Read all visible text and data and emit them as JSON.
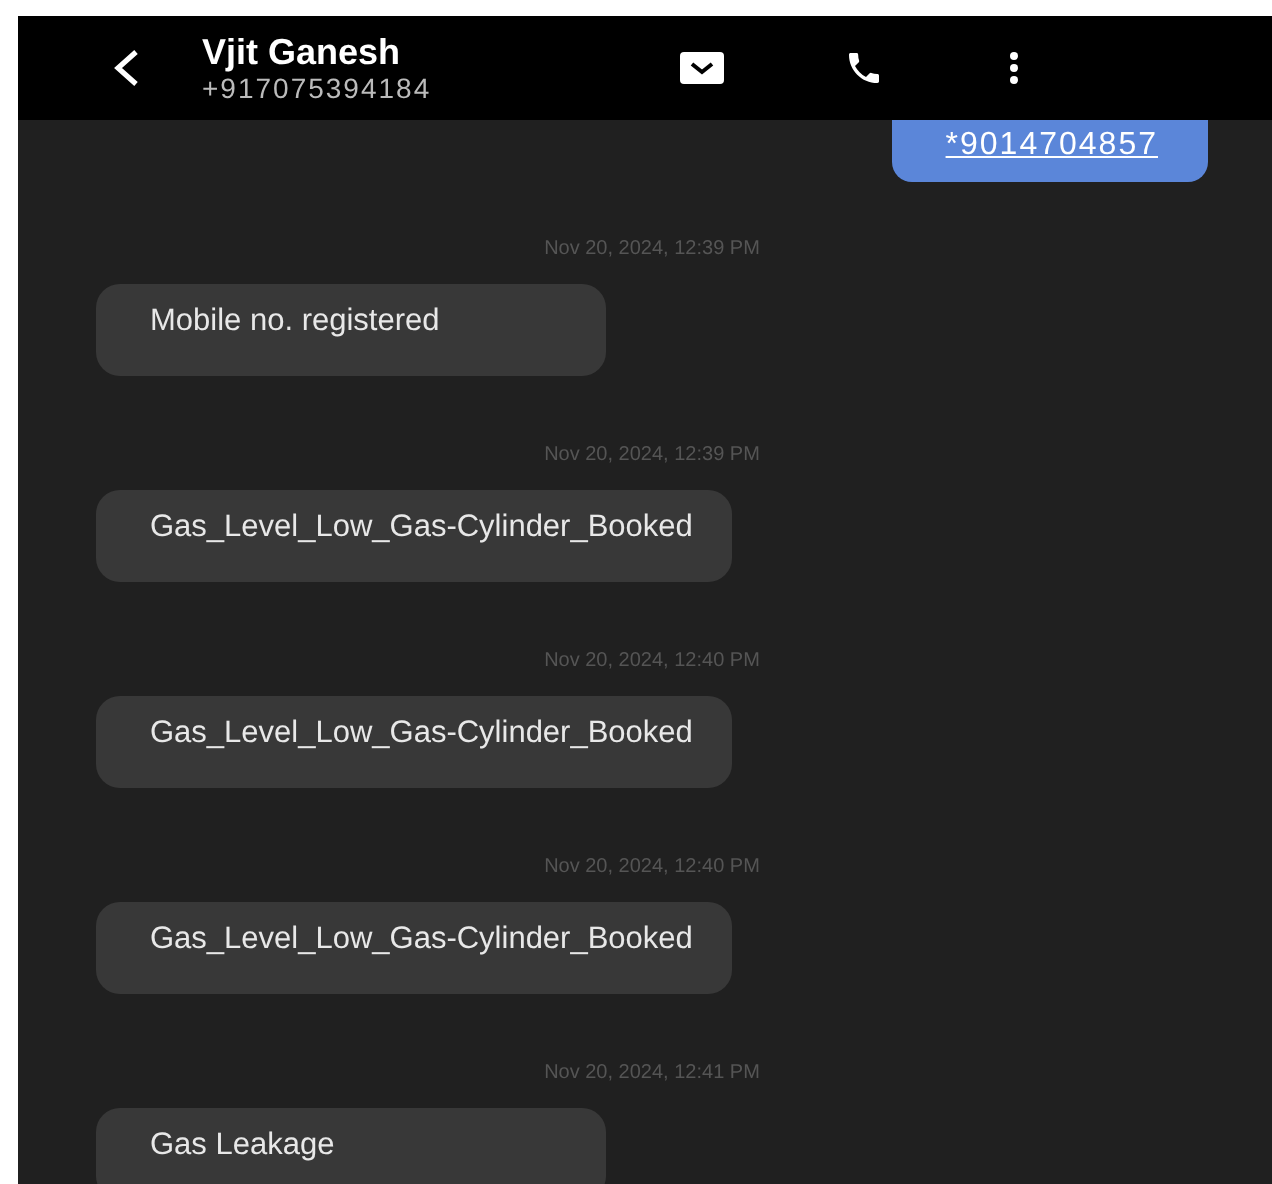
{
  "header": {
    "name": "Vjit Ganesh",
    "number": "+917075394184"
  },
  "messages": [
    {
      "kind": "sent",
      "text": "*9014704857"
    },
    {
      "kind": "timestamp",
      "text": "Nov 20, 2024, 12:39 PM"
    },
    {
      "kind": "received",
      "text": "Mobile no. registered"
    },
    {
      "kind": "timestamp",
      "text": "Nov 20, 2024, 12:39 PM"
    },
    {
      "kind": "received",
      "text": "Gas_Level_Low_Gas-Cylinder_Booked"
    },
    {
      "kind": "timestamp",
      "text": "Nov 20, 2024, 12:40 PM"
    },
    {
      "kind": "received",
      "text": "Gas_Level_Low_Gas-Cylinder_Booked"
    },
    {
      "kind": "timestamp",
      "text": "Nov 20, 2024, 12:40 PM"
    },
    {
      "kind": "received",
      "text": "Gas_Level_Low_Gas-Cylinder_Booked"
    },
    {
      "kind": "timestamp",
      "text": "Nov 20, 2024, 12:41 PM"
    },
    {
      "kind": "received",
      "text": "Gas Leakage"
    }
  ]
}
